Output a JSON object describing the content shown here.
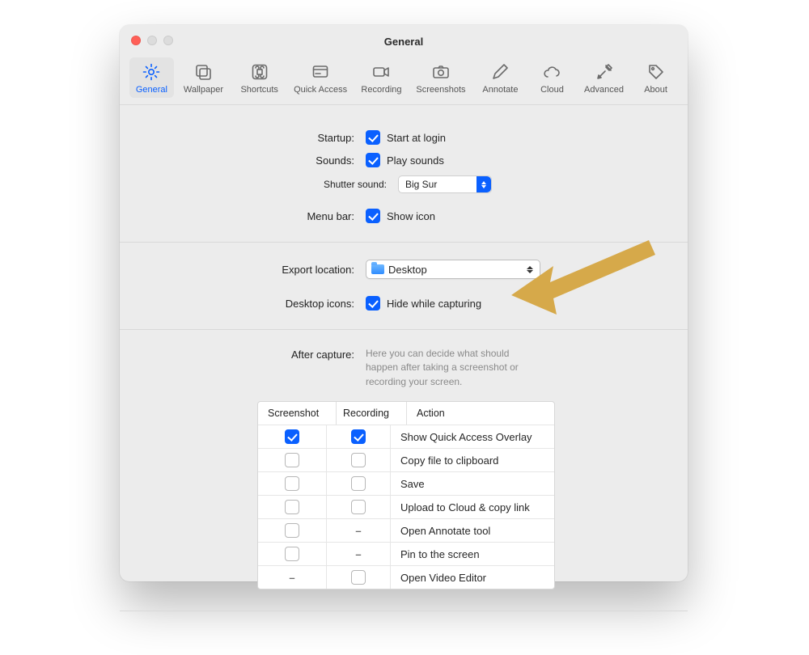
{
  "window": {
    "title": "General"
  },
  "toolbar": {
    "items": [
      {
        "id": "general",
        "label": "General",
        "icon": "gear"
      },
      {
        "id": "wallpaper",
        "label": "Wallpaper",
        "icon": "wallpaper"
      },
      {
        "id": "shortcuts",
        "label": "Shortcuts",
        "icon": "command"
      },
      {
        "id": "quick_access",
        "label": "Quick Access",
        "icon": "quick"
      },
      {
        "id": "recording",
        "label": "Recording",
        "icon": "video"
      },
      {
        "id": "screenshots",
        "label": "Screenshots",
        "icon": "camera"
      },
      {
        "id": "annotate",
        "label": "Annotate",
        "icon": "pencil"
      },
      {
        "id": "cloud",
        "label": "Cloud",
        "icon": "cloud"
      },
      {
        "id": "advanced",
        "label": "Advanced",
        "icon": "tools"
      },
      {
        "id": "about",
        "label": "About",
        "icon": "tag"
      }
    ],
    "active": "general"
  },
  "section_basic": {
    "startup": {
      "label": "Startup:",
      "checkbox_label": "Start at login",
      "checked": true
    },
    "sounds": {
      "label": "Sounds:",
      "checkbox_label": "Play sounds",
      "checked": true
    },
    "shutter": {
      "label": "Shutter sound:",
      "value": "Big Sur"
    },
    "menubar": {
      "label": "Menu bar:",
      "checkbox_label": "Show icon",
      "checked": true
    }
  },
  "section_export": {
    "export_location": {
      "label": "Export location:",
      "value": "Desktop"
    },
    "desktop_icons": {
      "label": "Desktop icons:",
      "checkbox_label": "Hide while capturing",
      "checked": true
    }
  },
  "section_after": {
    "label": "After capture:",
    "note": "Here you can decide what should happen after taking a screenshot or recording your screen.",
    "columns": {
      "screenshot": "Screenshot",
      "recording": "Recording",
      "action": "Action"
    },
    "rows": [
      {
        "screenshot": "checked",
        "recording": "checked",
        "action": "Show Quick Access Overlay"
      },
      {
        "screenshot": "unchecked",
        "recording": "unchecked",
        "action": "Copy file to clipboard"
      },
      {
        "screenshot": "unchecked",
        "recording": "unchecked",
        "action": "Save"
      },
      {
        "screenshot": "unchecked",
        "recording": "unchecked",
        "action": "Upload to Cloud & copy link"
      },
      {
        "screenshot": "unchecked",
        "recording": "dash",
        "action": "Open Annotate tool"
      },
      {
        "screenshot": "unchecked",
        "recording": "dash",
        "action": "Pin to the screen"
      },
      {
        "screenshot": "dash",
        "recording": "unchecked",
        "action": "Open Video Editor"
      }
    ]
  }
}
